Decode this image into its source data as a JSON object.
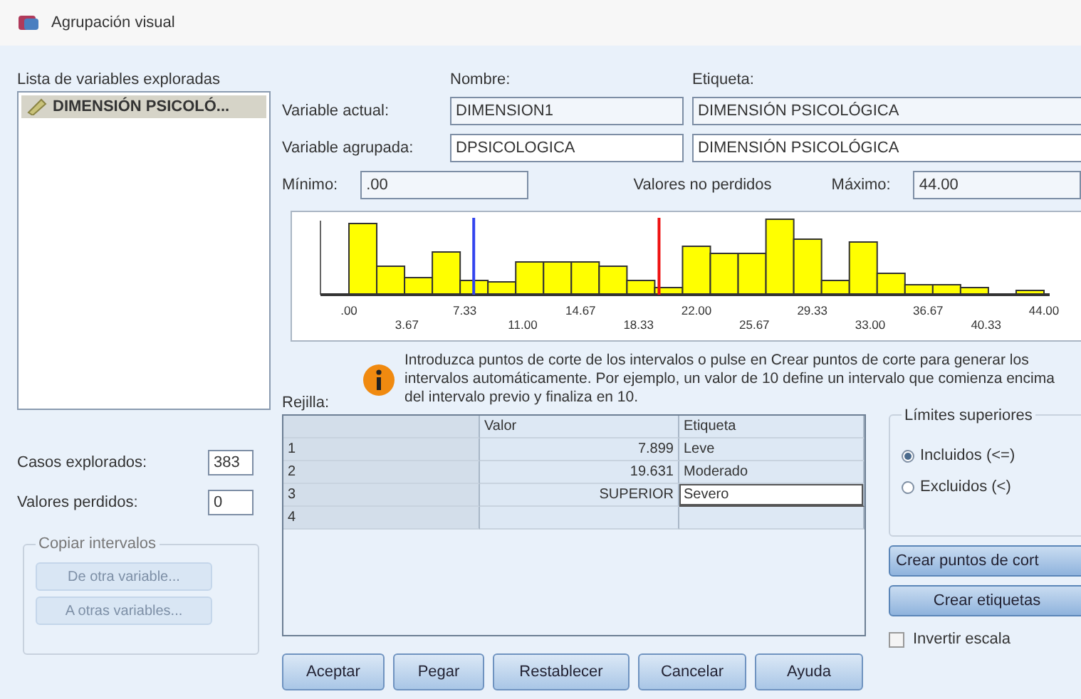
{
  "window": {
    "title": "Agrupación visual"
  },
  "scanned_list": {
    "label": "Lista de variables exploradas",
    "items": [
      {
        "text": "DIMENSIÓN PSICOLÓ...",
        "selected": true
      }
    ]
  },
  "headers": {
    "name": "Nombre:",
    "label": "Etiqueta:"
  },
  "current_variable": {
    "label": "Variable actual:",
    "name": "DIMENSION1",
    "var_label": "DIMENSIÓN PSICOLÓGICA"
  },
  "binned_variable": {
    "label": "Variable agrupada:",
    "name": "DPSICOLOGICA",
    "var_label": "DIMENSIÓN PSICOLÓGICA"
  },
  "minimum": {
    "label": "Mínimo:",
    "value": ".00"
  },
  "nonmissing_label": "Valores no perdidos",
  "maximum": {
    "label": "Máximo:",
    "value": "44.00"
  },
  "histogram": {
    "tick_labels": [
      ".00",
      "3.67",
      "7.33",
      "11.00",
      "14.67",
      "18.33",
      "22.00",
      "25.67",
      "29.33",
      "33.00",
      "36.67",
      "40.33",
      "44.00"
    ]
  },
  "info": "Introduzca puntos de corte de los intervalos o pulse en Crear puntos de corte para generar los intervalos automáticamente. Por ejemplo, un valor de 10 define un intervalo que comienza encima del intervalo previo y finaliza en 10.",
  "grid": {
    "label": "Rejilla:",
    "columns": [
      "Valor",
      "Etiqueta"
    ],
    "rows": [
      {
        "index": "1",
        "cutpoint": "7.899",
        "bin_label": "Leve",
        "editing": false
      },
      {
        "index": "2",
        "cutpoint": "19.631",
        "bin_label": "Moderado",
        "editing": false
      },
      {
        "index": "3",
        "cutpoint": "SUPERIOR",
        "bin_label": "Severo",
        "editing": true
      },
      {
        "index": "4",
        "editing": false
      }
    ]
  },
  "scanned_cases": {
    "label": "Casos explorados:",
    "value": "383"
  },
  "missing_values": {
    "label": "Valores perdidos:",
    "value": "0"
  },
  "copy_bins": {
    "title": "Copiar intervalos",
    "buttons": [
      {
        "text": "De otra variable...",
        "disabled": true
      },
      {
        "text": "A otras variables...",
        "disabled": true
      }
    ]
  },
  "upper_limits": {
    "title": "Límites superiores",
    "options": [
      {
        "text": "Incluidos (<=)",
        "selected": true
      },
      {
        "text": "Excluidos (<)",
        "selected": false
      }
    ]
  },
  "actions": [
    "Crear puntos de cort",
    "Crear etiquetas"
  ],
  "reverse_scale": {
    "text": "Invertir escala",
    "checked": false
  },
  "buttons": [
    "Aceptar",
    "Pegar",
    "Restablecer",
    "Cancelar",
    "Ayuda"
  ]
}
